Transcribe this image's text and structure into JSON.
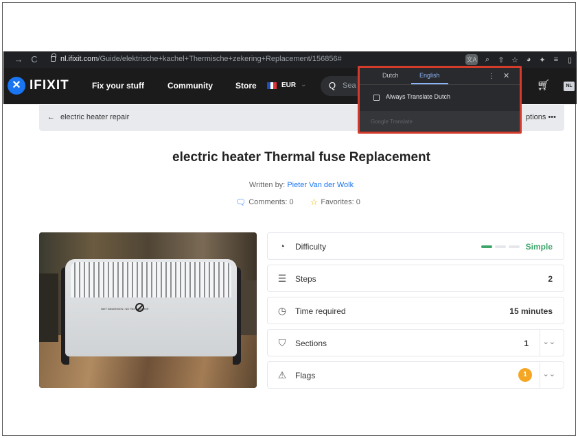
{
  "browser": {
    "back_icon": "arrow-right-icon",
    "reload_icon": "reload-icon",
    "url_domain": "nl.ifixit.com",
    "url_path": "/Guide/elektrische+kachel+Thermische+zekering+Replacement/156856#"
  },
  "site_header": {
    "logo_text": "IFIXIT",
    "nav": [
      "Fix your stuff",
      "Community",
      "Store"
    ],
    "currency": "EUR",
    "search_placeholder": "Sea",
    "language_badge": "NL"
  },
  "breadcrumb": {
    "label": "electric heater repair",
    "options_label": "ptions"
  },
  "translate_popup": {
    "source_language": "Dutch",
    "target_language": "English",
    "always_translate_label": "Always Translate Dutch",
    "footer": "Google Translate",
    "highlight_color": "#d33b2c"
  },
  "guide": {
    "title": "electric heater Thermal fuse Replacement",
    "written_by_label": "Written by:",
    "author": "Pieter Van der Wolk",
    "comments_label": "Comments:",
    "comments_count": "0",
    "favorites_label": "Favorites:",
    "favorites_count": "0",
    "image_text": "NIET BEDEKKEN • NE PAS COUVRIR"
  },
  "details": {
    "difficulty_label": "Difficulty",
    "difficulty_value": "Simple",
    "difficulty_level": 1,
    "difficulty_max": 3,
    "steps_label": "Steps",
    "steps_value": "2",
    "time_label": "Time required",
    "time_value": "15 minutes",
    "sections_label": "Sections",
    "sections_value": "1",
    "flags_label": "Flags",
    "flags_value": "1"
  },
  "colors": {
    "brand_blue": "#1975f2",
    "difficulty_green": "#3ea66b",
    "flag_orange": "#f5a623",
    "header_bg": "#1b1b1b"
  }
}
